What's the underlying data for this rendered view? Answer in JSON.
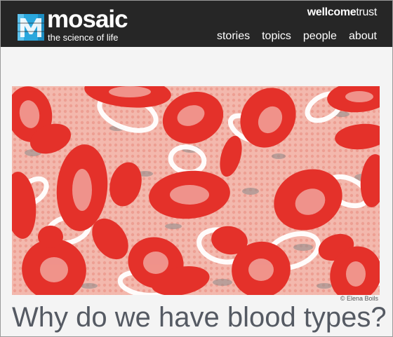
{
  "header": {
    "brand_name": "mosaic",
    "tagline": "the science of life",
    "sponsor_bold": "wellcome",
    "sponsor_light": "trust",
    "nav": [
      "stories",
      "topics",
      "people",
      "about"
    ]
  },
  "hero": {
    "credit": "© Elena Boils"
  },
  "article": {
    "title": "Why do we have blood types?"
  },
  "colors": {
    "header_bg": "#262626",
    "logo_accent": "#2aa7dd",
    "cell_red": "#e4312a",
    "hero_bg": "#f2b2a6",
    "title_text": "#555a63"
  },
  "icons": [
    "mosaic-logo-icon"
  ]
}
